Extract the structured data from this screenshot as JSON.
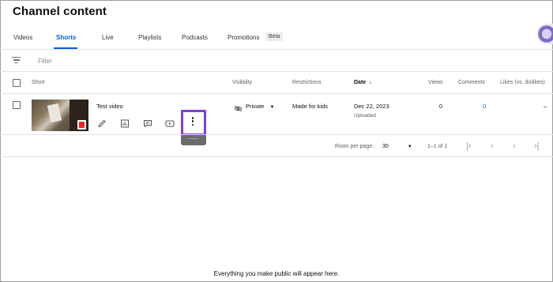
{
  "page": {
    "title": "Channel content"
  },
  "tabs": [
    {
      "label": "Videos",
      "active": false
    },
    {
      "label": "Shorts",
      "active": true
    },
    {
      "label": "Live",
      "active": false
    },
    {
      "label": "Playlists",
      "active": false
    },
    {
      "label": "Podcasts",
      "active": false
    },
    {
      "label": "Promotions",
      "active": false,
      "badge": "Beta"
    }
  ],
  "filter": {
    "label": "Filter"
  },
  "columns": {
    "short": "Short",
    "visibility": "Visibility",
    "restrictions": "Restrictions",
    "date": "Date",
    "views": "Views",
    "comments": "Comments",
    "likes": "Likes (vs. dislikes)"
  },
  "rows": [
    {
      "title": "Test video",
      "visibility": "Private",
      "restrictions": "Made for kids",
      "date": "Dec 22, 2023",
      "date_status": "Uploaded",
      "views": "0",
      "comments": "0",
      "likes": "–",
      "actions": [
        "pencil-icon",
        "analytics-icon",
        "comments-icon",
        "youtube-icon",
        "more-options-icon"
      ]
    }
  ],
  "pagination": {
    "rows_per_page_label": "Rows per page:",
    "rows_per_page": "30",
    "range": "1–1 of 1"
  },
  "footer": {
    "message": "Everything you make public will appear here."
  },
  "colors": {
    "accent": "#065fd4",
    "highlight": "#7b3fe4",
    "shorts_red": "#ff1f1f"
  }
}
